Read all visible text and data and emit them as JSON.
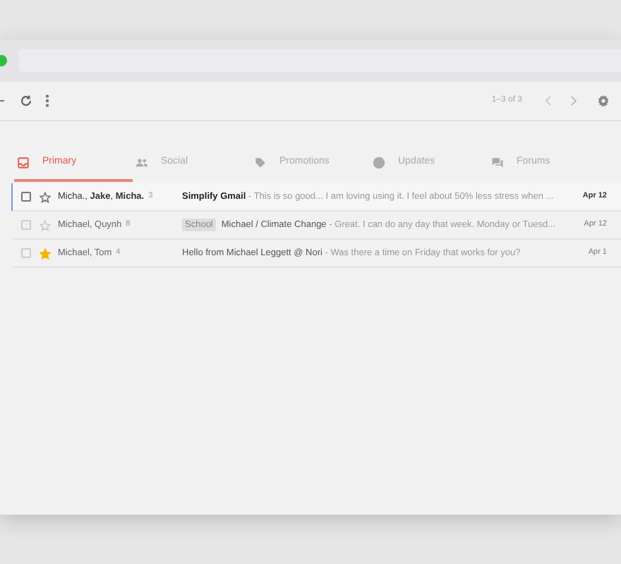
{
  "toolbar": {
    "page_info": "1–3 of 3"
  },
  "tabs": [
    {
      "label": "Primary",
      "selected": true
    },
    {
      "label": "Social",
      "selected": false
    },
    {
      "label": "Promotions",
      "selected": false
    },
    {
      "label": "Updates",
      "selected": false
    },
    {
      "label": "Forums",
      "selected": false
    }
  ],
  "emails": [
    {
      "unread": true,
      "starred": false,
      "senders": "Micha., **Jake**, **Micha.**",
      "count": "3",
      "subject": "Simplify Gmail",
      "snippet": " - This is so good... I am loving using it. I feel about 50% less stress when ...",
      "date": "Apr 12"
    },
    {
      "unread": false,
      "starred": false,
      "senders": "Michael, Quynh",
      "count": "8",
      "label": "School",
      "subject": "Michael / Climate Change",
      "snippet": " - Great. I can do any day that week. Monday or Tuesd...",
      "date": "Apr 12"
    },
    {
      "unread": false,
      "starred": true,
      "senders": "Michael, Tom",
      "count": "4",
      "subject": "Hello from Michael Leggett @ Nori",
      "snippet": " - Was there a time on Friday that works for you?",
      "date": "Apr 1"
    }
  ]
}
